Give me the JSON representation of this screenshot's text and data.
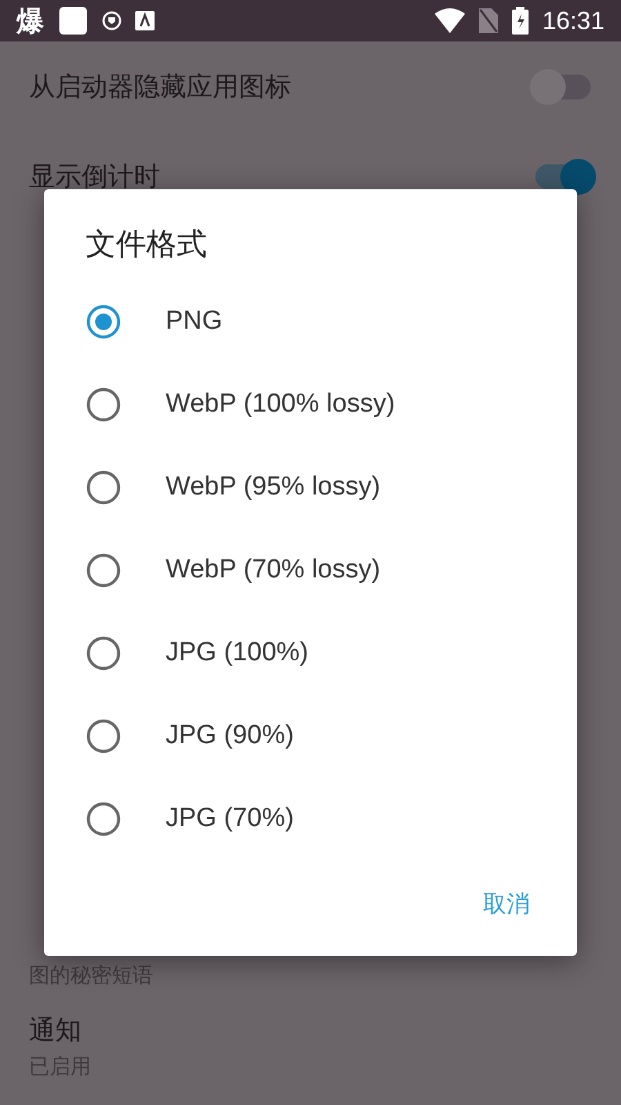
{
  "status_bar": {
    "notification_glyph": "爆",
    "time": "16:31"
  },
  "settings": [
    {
      "kind": "switch",
      "title": "从启动器隐藏应用图标",
      "on": false
    },
    {
      "kind": "switch",
      "title": "显示倒计时",
      "on": true
    },
    {
      "kind": "text",
      "summary": "图的秘密短语"
    },
    {
      "kind": "text",
      "title": "通知",
      "summary": "已启用"
    }
  ],
  "dialog": {
    "title": "文件格式",
    "options": [
      {
        "label": "PNG",
        "selected": true
      },
      {
        "label": "WebP (100% lossy)",
        "selected": false
      },
      {
        "label": "WebP (95% lossy)",
        "selected": false
      },
      {
        "label": "WebP (70% lossy)",
        "selected": false
      },
      {
        "label": "JPG (100%)",
        "selected": false
      },
      {
        "label": "JPG (90%)",
        "selected": false
      },
      {
        "label": "JPG (70%)",
        "selected": false
      }
    ],
    "cancel": "取消"
  }
}
